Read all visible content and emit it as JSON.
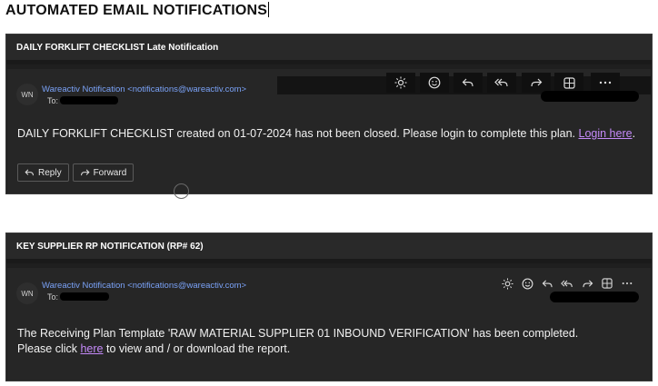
{
  "page_title": "AUTOMATED EMAIL NOTIFICATIONS",
  "emails": [
    {
      "subject": "DAILY FORKLIFT CHECKLIST Late Notification",
      "avatar": "WN",
      "sender": "Wareactiv Notification <notifications@wareactiv.com>",
      "to_label": "To:",
      "body_text": "DAILY FORKLIFT CHECKLIST created on 01-07-2024 has not been closed. Please login to complete this plan.",
      "link_text": "Login here",
      "after_link": ".",
      "reply_label": "Reply",
      "forward_label": "Forward",
      "toolbar_icons": [
        "sun-icon",
        "emoji-icon",
        "reply-icon",
        "reply-all-icon",
        "forward-icon",
        "grid-icon",
        "more-icon"
      ]
    },
    {
      "subject": "KEY SUPPLIER RP NOTIFICATION (RP# 62)",
      "avatar": "WN",
      "sender": "Wareactiv Notification <notifications@wareactiv.com>",
      "to_label": "To:",
      "body_line1": "The Receiving Plan Template 'RAW MATERIAL SUPPLIER 01 INBOUND VERIFICATION' has been completed.",
      "body_line2_pre": "Please click",
      "link_text": "here",
      "body_line2_post": "to view and / or download the report.",
      "toolbar_icons": [
        "sun-icon",
        "emoji-icon",
        "reply-icon",
        "reply-all-icon",
        "forward-icon",
        "grid-icon",
        "more-icon"
      ]
    }
  ],
  "colors": {
    "sender": "#7aa2f7",
    "link": "#c58af9",
    "panel": "#1f1f1f"
  }
}
